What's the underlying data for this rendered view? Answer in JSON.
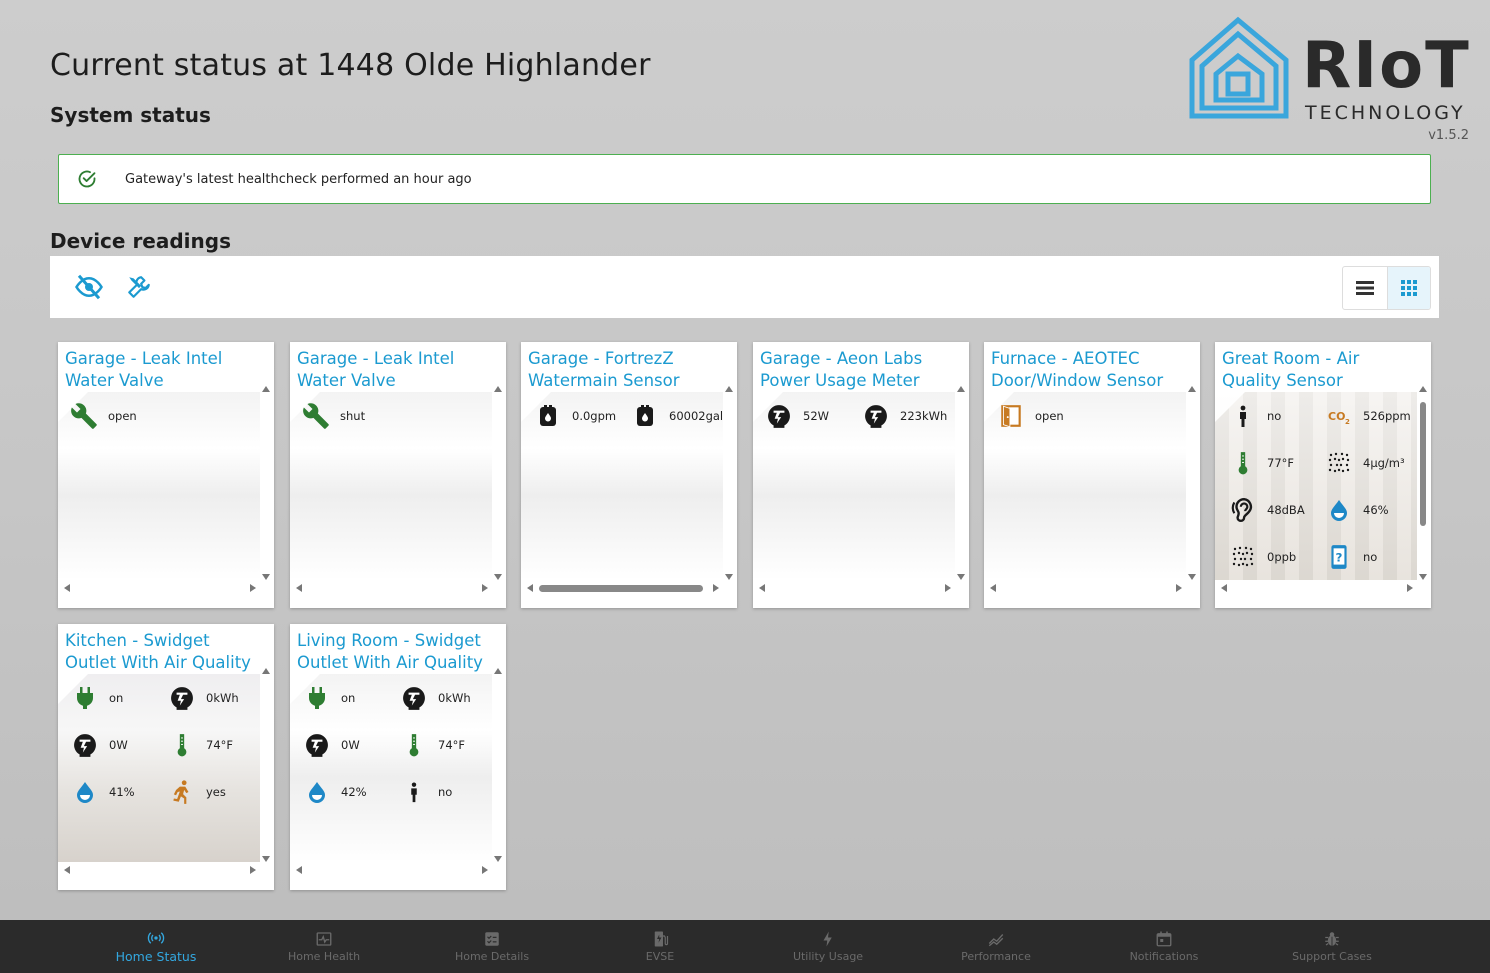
{
  "header": {
    "title": "Current status at 1448 Olde Highlander",
    "system_status_label": "System status",
    "device_readings_label": "Device readings"
  },
  "logo": {
    "brand": "RIoT",
    "subtitle": "TECHNOLOGY",
    "version": "v1.5.2",
    "color": "#3aa6dc"
  },
  "health": {
    "message": "Gateway's latest healthcheck performed an hour ago",
    "color": "#4caf50"
  },
  "toolbar": {
    "hide_icon": "eye-off-icon",
    "tools_icon": "tools-icon",
    "list_view_icon": "list-icon",
    "grid_view_icon": "grid-icon",
    "active_view": "grid"
  },
  "colors": {
    "title_blue": "#1b9ad0",
    "green": "#2e7d32",
    "orange": "#c77a22",
    "drop_blue": "#1e88c7",
    "nav_active": "#33a8e0"
  },
  "cards": [
    {
      "title_line1": "Garage - Leak Intel",
      "title_line2": "Water Valve",
      "readings": [
        {
          "icon": "wrench-icon",
          "value": "open"
        }
      ]
    },
    {
      "title_line1": "Garage - Leak Intel",
      "title_line2": "Water Valve",
      "readings": [
        {
          "icon": "wrench-icon",
          "value": "shut"
        }
      ]
    },
    {
      "title_line1": "Garage - FortrezZ",
      "title_line2": "Watermain Sensor",
      "readings": [
        {
          "icon": "water-meter-icon",
          "value": "0.0gpm"
        },
        {
          "icon": "water-meter-icon",
          "value": "60002gal"
        }
      ]
    },
    {
      "title_line1": "Garage - Aeon Labs",
      "title_line2": "Power Usage Meter",
      "readings": [
        {
          "icon": "power-meter-icon",
          "value": "52W"
        },
        {
          "icon": "power-meter-icon",
          "value": "223kWh"
        }
      ]
    },
    {
      "title_line1": "Furnace - AEOTEC",
      "title_line2": "Door/Window Sensor",
      "readings": [
        {
          "icon": "door-open-icon",
          "value": "open"
        }
      ]
    },
    {
      "title_line1": "Great Room - Air",
      "title_line2": "Quality Sensor",
      "readings": [
        {
          "icon": "person-icon",
          "value": "no"
        },
        {
          "icon": "co2-icon",
          "value": "526ppm",
          "label": "CO2"
        },
        {
          "icon": "thermometer-icon",
          "value": "77°F"
        },
        {
          "icon": "particles-icon",
          "value": "4µg/m³"
        },
        {
          "icon": "sound-icon",
          "value": "48dBA"
        },
        {
          "icon": "humidity-icon",
          "value": "46%"
        },
        {
          "icon": "particles-icon",
          "value": "0ppb"
        },
        {
          "icon": "unknown-device-icon",
          "value": "no"
        }
      ]
    },
    {
      "title_line1": "Kitchen - Swidget",
      "title_line2": "Outlet With Air Quality",
      "readings": [
        {
          "icon": "plug-icon",
          "value": "on"
        },
        {
          "icon": "power-meter-icon",
          "value": "0kWh"
        },
        {
          "icon": "power-meter-icon",
          "value": "0W"
        },
        {
          "icon": "thermometer-icon",
          "value": "74°F"
        },
        {
          "icon": "humidity-icon",
          "value": "41%"
        },
        {
          "icon": "running-person-icon",
          "value": "yes"
        }
      ]
    },
    {
      "title_line1": "Living Room - Swidget",
      "title_line2": "Outlet With Air Quality",
      "readings": [
        {
          "icon": "plug-icon",
          "value": "on"
        },
        {
          "icon": "power-meter-icon",
          "value": "0kWh"
        },
        {
          "icon": "power-meter-icon",
          "value": "0W"
        },
        {
          "icon": "thermometer-icon",
          "value": "74°F"
        },
        {
          "icon": "humidity-icon",
          "value": "42%"
        },
        {
          "icon": "person-icon",
          "value": "no"
        }
      ]
    }
  ],
  "nav": [
    {
      "label": "Home Status",
      "icon": "broadcast-icon",
      "active": true
    },
    {
      "label": "Home Health",
      "icon": "heartbeat-icon",
      "active": false
    },
    {
      "label": "Home Details",
      "icon": "checklist-icon",
      "active": false
    },
    {
      "label": "EVSE",
      "icon": "ev-charger-icon",
      "active": false
    },
    {
      "label": "Utility Usage",
      "icon": "lightning-icon",
      "active": false
    },
    {
      "label": "Performance",
      "icon": "trend-icon",
      "active": false
    },
    {
      "label": "Notifications",
      "icon": "calendar-icon",
      "active": false
    },
    {
      "label": "Support Cases",
      "icon": "bug-icon",
      "active": false
    }
  ]
}
